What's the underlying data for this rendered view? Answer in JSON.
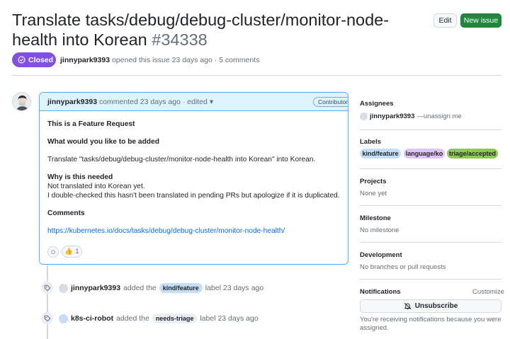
{
  "header": {
    "title": "Translate tasks/debug/debug-cluster/monitor-node-health into Korean",
    "issue_number": "#34338",
    "edit_label": "Edit",
    "new_issue_label": "New issue"
  },
  "status": {
    "state_label": "Closed",
    "author": "jinnypark9393",
    "meta_text": "opened this issue 23 days ago · 5 comments"
  },
  "comment": {
    "author": "jinnypark9393",
    "meta": "commented 23 days ago · edited",
    "badge": "Contributor",
    "body": {
      "line1": "This is a Feature Request",
      "line2": "What would you like to be added",
      "line3": "Translate \"tasks/debug/debug-cluster/monitor-node-health into Korean\" into Korean.",
      "line4": "Why is this needed",
      "line5": "Not translated into Korean yet.",
      "line6": "I double-checked this hasn't been translated in pending PRs but apologize if it is duplicated.",
      "line7": "Comments",
      "link": "https://kubernetes.io/docs/tasks/debug/debug-cluster/monitor-node-health/"
    },
    "reactions": {
      "thumbs_up_count": "1"
    }
  },
  "timeline": [
    {
      "actor": "jinnypark9393",
      "verb": "added the",
      "label": "kind/feature",
      "suffix": "label 23 days ago"
    },
    {
      "actor": "k8s-ci-robot",
      "verb": "added the",
      "label": "needs-triage",
      "suffix": "label 23 days ago"
    }
  ],
  "sidebar": {
    "assignees_heading": "Assignees",
    "assignee_name": "jinnypark9393",
    "assignee_action": "—unassign me",
    "labels_heading": "Labels",
    "labels": [
      {
        "name": "kind/feature",
        "bg": "#c5def5",
        "fg": "#1f2328"
      },
      {
        "name": "language/ko",
        "bg": "#e0c4f4",
        "fg": "#1f2328"
      },
      {
        "name": "triage/accepted",
        "bg": "#8fc951",
        "fg": "#1f2328"
      }
    ],
    "projects_heading": "Projects",
    "projects_value": "None yet",
    "milestone_heading": "Milestone",
    "milestone_value": "No milestone",
    "development_heading": "Development",
    "development_value": "No branches or pull requests",
    "notifications_heading": "Notifications",
    "customize_label": "Customize",
    "unsubscribe_label": "Unsubscribe",
    "notification_reason": "You're receiving notifications because you were",
    "notification_reason_2": "assigned."
  },
  "colors": {
    "closed": "#8250df",
    "new_issue": "#1f883d",
    "link": "#0969da"
  }
}
